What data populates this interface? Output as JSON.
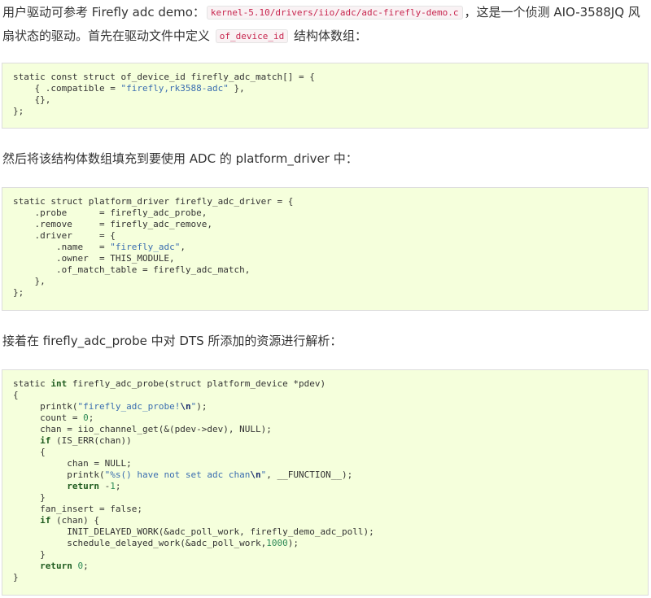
{
  "paragraphs": [
    {
      "parts": [
        {
          "type": "text",
          "value": "用户驱动可参考 Firefly adc demo："
        },
        {
          "type": "code",
          "value": "kernel-5.10/drivers/iio/adc/adc-firefly-demo.c"
        },
        {
          "type": "text",
          "value": "，这是一个侦测 AIO-3588JQ 风扇状态的驱动。首先在驱动文件中定义 "
        },
        {
          "type": "code",
          "value": "of_device_id"
        },
        {
          "type": "text",
          "value": " 结构体数组："
        }
      ]
    },
    {
      "parts": [
        {
          "type": "text",
          "value": "然后将该结构体数组填充到要使用 ADC 的 platform_driver 中："
        }
      ]
    },
    {
      "parts": [
        {
          "type": "text",
          "value": "接着在 firefly_adc_probe 中对 DTS 所添加的资源进行解析："
        }
      ]
    }
  ],
  "code_blocks": [
    {
      "lines": [
        [
          [
            "p",
            "static const struct of_device_id firefly_adc_match[] = {"
          ]
        ],
        [
          [
            "p",
            "    { .compatible = "
          ],
          [
            "s",
            "\"firefly,rk3588-adc\""
          ],
          [
            "p",
            " },"
          ]
        ],
        [
          [
            "p",
            "    {},"
          ]
        ],
        [
          [
            "p",
            "};"
          ]
        ]
      ]
    },
    {
      "lines": [
        [
          [
            "p",
            "static struct platform_driver firefly_adc_driver = {"
          ]
        ],
        [
          [
            "p",
            "    .probe      = firefly_adc_probe,"
          ]
        ],
        [
          [
            "p",
            "    .remove     = firefly_adc_remove,"
          ]
        ],
        [
          [
            "p",
            "    .driver     = {"
          ]
        ],
        [
          [
            "p",
            "        .name   = "
          ],
          [
            "s",
            "\"firefly_adc\""
          ],
          [
            "p",
            ","
          ]
        ],
        [
          [
            "p",
            "        .owner  = THIS_MODULE,"
          ]
        ],
        [
          [
            "p",
            "        .of_match_table = firefly_adc_match,"
          ]
        ],
        [
          [
            "p",
            "    },"
          ]
        ],
        [
          [
            "p",
            "};"
          ]
        ]
      ]
    },
    {
      "lines": [
        [
          [
            "p",
            "static "
          ],
          [
            "k",
            "int"
          ],
          [
            "p",
            " firefly_adc_probe(struct platform_device *pdev)"
          ]
        ],
        [
          [
            "p",
            "{"
          ]
        ],
        [
          [
            "p",
            "     printk("
          ],
          [
            "s",
            "\"firefly_adc_probe!"
          ],
          [
            "e",
            "\\n"
          ],
          [
            "s",
            "\""
          ],
          [
            "p",
            ");"
          ]
        ],
        [
          [
            "p",
            "     count = "
          ],
          [
            "n",
            "0"
          ],
          [
            "p",
            ";"
          ]
        ],
        [
          [
            "p",
            "     chan = iio_channel_get(&(pdev->dev), NULL);"
          ]
        ],
        [
          [
            "p",
            "     "
          ],
          [
            "k",
            "if"
          ],
          [
            "p",
            " (IS_ERR(chan))"
          ]
        ],
        [
          [
            "p",
            "     {"
          ]
        ],
        [
          [
            "p",
            "          chan = NULL;"
          ]
        ],
        [
          [
            "p",
            "          printk("
          ],
          [
            "s",
            "\"%s() have not set adc chan"
          ],
          [
            "e",
            "\\n"
          ],
          [
            "s",
            "\""
          ],
          [
            "p",
            ", __FUNCTION__);"
          ]
        ],
        [
          [
            "p",
            "          "
          ],
          [
            "k",
            "return"
          ],
          [
            "p",
            " -"
          ],
          [
            "n",
            "1"
          ],
          [
            "p",
            ";"
          ]
        ],
        [
          [
            "p",
            "     }"
          ]
        ],
        [
          [
            "p",
            "     fan_insert = false;"
          ]
        ],
        [
          [
            "p",
            "     "
          ],
          [
            "k",
            "if"
          ],
          [
            "p",
            " (chan) {"
          ]
        ],
        [
          [
            "p",
            "          INIT_DELAYED_WORK(&adc_poll_work, firefly_demo_adc_poll);"
          ]
        ],
        [
          [
            "p",
            "          schedule_delayed_work(&adc_poll_work,"
          ],
          [
            "n",
            "1000"
          ],
          [
            "p",
            ");"
          ]
        ],
        [
          [
            "p",
            "     }"
          ]
        ],
        [
          [
            "p",
            "     "
          ],
          [
            "k",
            "return"
          ],
          [
            "p",
            " "
          ],
          [
            "n",
            "0"
          ],
          [
            "p",
            ";"
          ]
        ],
        [
          [
            "p",
            "}"
          ]
        ]
      ]
    }
  ],
  "colors": {
    "code_background": "#f5ffdc",
    "inline_code_text": "#c7254e",
    "string": "#3a6db0",
    "number": "#2e8b57",
    "keyword": "#1f5c1f"
  }
}
